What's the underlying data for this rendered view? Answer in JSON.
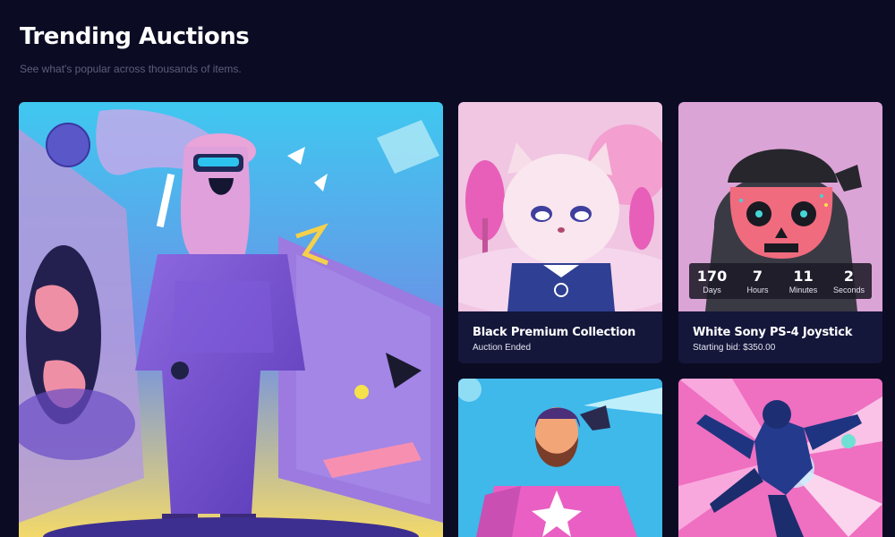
{
  "header": {
    "title": "Trending Auctions",
    "subtitle": "See what's popular across thousands of items."
  },
  "cards": {
    "featured": {
      "art": "vr-headset-woman-illustration"
    },
    "cat": {
      "art": "3d-cat-character",
      "title": "Black Premium Collection",
      "status": "Auction Ended"
    },
    "skull": {
      "art": "skull-bandana-character",
      "title": "White Sony PS-4 Joystick",
      "bid": "Starting bid: $350.00",
      "countdown": {
        "days": "170",
        "days_label": "Days",
        "hours": "7",
        "hours_label": "Hours",
        "minutes": "11",
        "minutes_label": "Minutes",
        "seconds": "2",
        "seconds_label": "Seconds"
      }
    },
    "man": {
      "art": "bearded-man-pink-hoodie-illustration"
    },
    "ninja": {
      "art": "ninja-jump-kick-illustration"
    }
  },
  "colors": {
    "background": "#0b0b23",
    "card": "#14163a",
    "subtitle": "#5c5f7a"
  }
}
